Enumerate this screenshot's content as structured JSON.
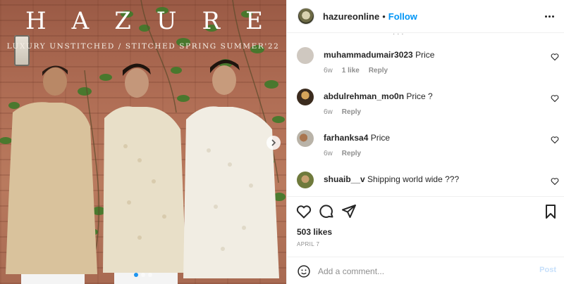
{
  "photo": {
    "brand_title": "HAZURE",
    "brand_subtitle": "LUXURY UNSTITCHED / STITCHED SPRING SUMMER'22",
    "slide_count": 3,
    "active_slide": 1,
    "colors": {
      "brick": "#b06e55",
      "vine": "#3f7a2a",
      "kurta_beige": "#d9c29c",
      "kurta_cream": "#e8dfc8",
      "kurta_white": "#f1ede3"
    }
  },
  "header": {
    "username": "hazureonline",
    "separator": "•",
    "follow_label": "Follow",
    "more_icon": "more-horizontal-icon"
  },
  "comments": [
    {
      "username": "muhammadumair3023",
      "text": "Price",
      "age": "6w",
      "likes": "1 like",
      "reply_label": "Reply",
      "avatar_color": "#cfc8c0"
    },
    {
      "username": "abdulrehman_mo0n",
      "text": "Price ?",
      "age": "6w",
      "likes": "",
      "reply_label": "Reply",
      "avatar_color": "#3b2b1e"
    },
    {
      "username": "farhanksa4",
      "text": "Price",
      "age": "6w",
      "likes": "",
      "reply_label": "Reply",
      "avatar_color": "#b9b3a8"
    },
    {
      "username": "shuaib__v",
      "text": "Shipping world wide ???",
      "age": "",
      "likes": "",
      "reply_label": "",
      "avatar_color": "#6f7a3c"
    }
  ],
  "actions": {
    "like_icon": "heart-icon",
    "comment_icon": "comment-bubble-icon",
    "share_icon": "send-paper-plane-icon",
    "save_icon": "bookmark-icon",
    "likes_count": "503 likes",
    "date": "APRIL 7"
  },
  "comment_box": {
    "emoji_icon": "smiley-icon",
    "placeholder": "Add a comment...",
    "post_label": "Post"
  }
}
